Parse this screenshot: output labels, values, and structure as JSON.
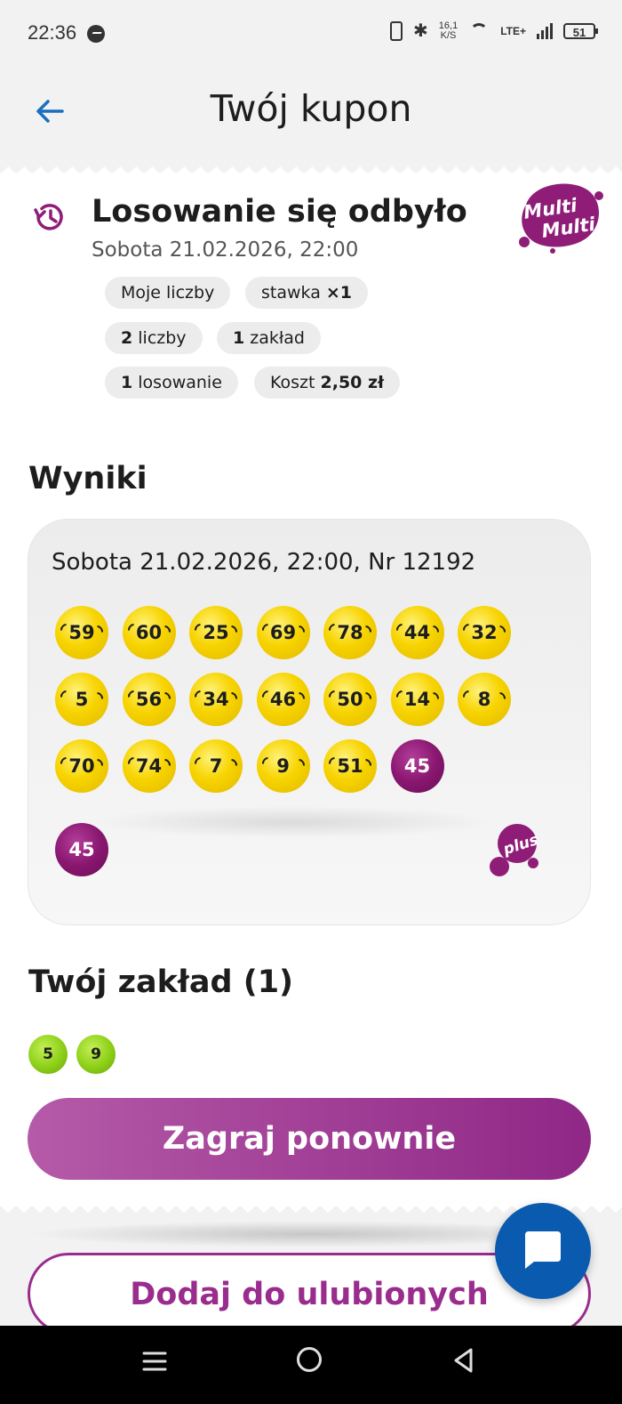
{
  "status_bar": {
    "time": "22:36",
    "speed_top": "16,1",
    "speed_bottom": "K/S",
    "network": "LTE+",
    "battery": "51"
  },
  "header": {
    "title": "Twój kupon"
  },
  "draw": {
    "status": "Losowanie się odbyło",
    "date": "Sobota 21.02.2026, 22:00",
    "logo_line1": "Multi",
    "logo_line2": "Multi"
  },
  "chips": {
    "my_numbers": "Moje liczby",
    "stake_label": "stawka ",
    "stake_value": "×1",
    "numbers_count": "2",
    "numbers_label": " liczby",
    "bets_count": "1",
    "bets_label": " zakład",
    "draws_count": "1",
    "draws_label": " losowanie",
    "cost_label": "Koszt ",
    "cost_value": "2,50 zł"
  },
  "results": {
    "section_title": "Wyniki",
    "heading": "Sobota 21.02.2026, 22:00, Nr 12192",
    "balls": [
      "59",
      "60",
      "25",
      "69",
      "78",
      "44",
      "32",
      "5",
      "56",
      "34",
      "46",
      "50",
      "14",
      "8",
      "70",
      "74",
      "7",
      "9",
      "51"
    ],
    "plus_ball_in_grid": "45",
    "plus_number": "45",
    "plus_logo_text": "plus"
  },
  "bet": {
    "section_title": "Twój zakład (1)",
    "numbers": [
      "5",
      "9"
    ]
  },
  "actions": {
    "play_again": "Zagraj ponownie",
    "add_favorite": "Dodaj do ulubionych"
  },
  "colors": {
    "accent_purple": "#9a2c8e",
    "ball_yellow": "#f7d400",
    "ball_green": "#8ccf17",
    "fab_blue": "#0a5bb0",
    "back_blue": "#1a6fbf"
  }
}
